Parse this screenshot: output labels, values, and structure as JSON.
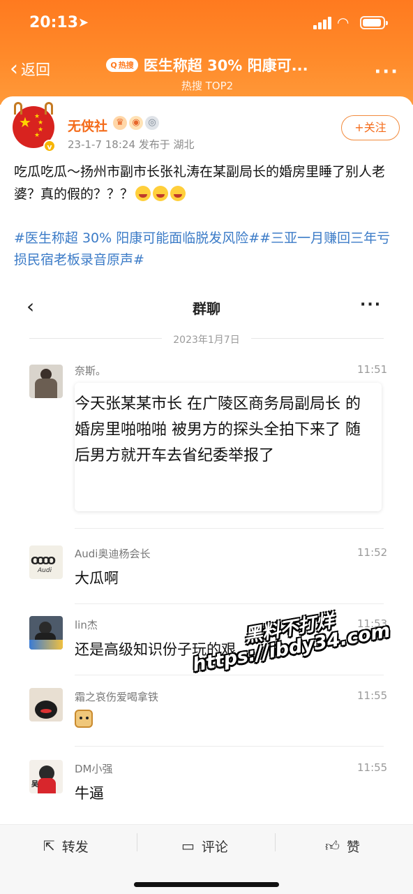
{
  "status_bar": {
    "time": "20:13"
  },
  "nav": {
    "back_label": "返回",
    "hot_badge": "热搜",
    "title": "医生称超 30% 阳康可...",
    "subtitle": "热搜 TOP2"
  },
  "post": {
    "author": "无侠社",
    "meta": "23-1-7 18:24  发布于 湖北",
    "follow_label": "+关注",
    "text": "吃瓜吃瓜～扬州市副市长张礼涛在某副局长的婚房里睡了别人老婆？真的假的？？？",
    "hashtags": "#医生称超 30% 阳康可能面临脱发风险##三亚一月赚回三年亏损民宿老板录音原声#"
  },
  "chat": {
    "title": "群聊",
    "date": "2023年1月7日",
    "messages": [
      {
        "name": "奈斯。",
        "time": "11:51",
        "text": "今天张某某市长  在广陵区商务局副局长 的婚房里啪啪啪 被男方的探头全拍下来了 随后男方就开车去省纪委举报了"
      },
      {
        "name": "Audi奥迪杨会长",
        "time": "11:52",
        "text": "大瓜啊"
      },
      {
        "name": "lin杰",
        "time": "11:53",
        "text": "还是高级知识份子玩的艰"
      },
      {
        "name": "霜之哀伤爱喝拿铁",
        "time": "11:55",
        "text": ""
      },
      {
        "name": "DM小强",
        "time": "11:55",
        "text": "牛逼"
      }
    ]
  },
  "watermark": {
    "line1": "黑料不打烊",
    "line2": "https://ibdy34.com"
  },
  "actions": {
    "repost": "转发",
    "comment": "评论",
    "like": "赞"
  },
  "colors": {
    "header_orange": "#ff7a1f",
    "link_blue": "#3b7bc7",
    "author_orange": "#f46b1a"
  }
}
